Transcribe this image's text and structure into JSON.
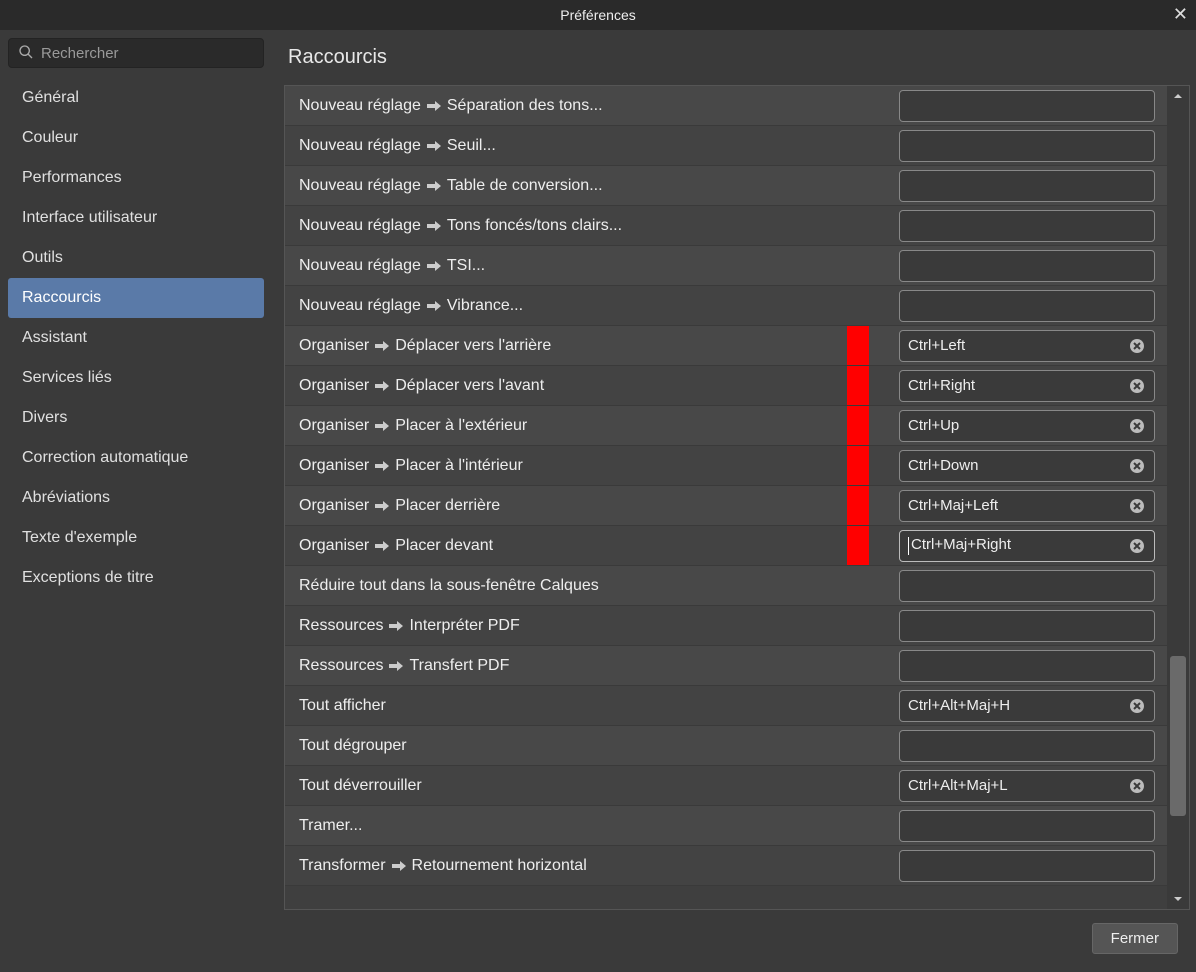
{
  "title": "Préférences",
  "search": {
    "placeholder": "Rechercher"
  },
  "sidebar": {
    "items": [
      {
        "label": "Général"
      },
      {
        "label": "Couleur"
      },
      {
        "label": "Performances"
      },
      {
        "label": "Interface utilisateur"
      },
      {
        "label": "Outils"
      },
      {
        "label": "Raccourcis",
        "selected": true
      },
      {
        "label": "Assistant"
      },
      {
        "label": "Services liés"
      },
      {
        "label": "Divers"
      },
      {
        "label": "Correction automatique"
      },
      {
        "label": "Abréviations"
      },
      {
        "label": "Texte d'exemple"
      },
      {
        "label": "Exceptions de titre"
      }
    ]
  },
  "main": {
    "title": "Raccourcis",
    "rows": [
      {
        "path": [
          "Nouveau réglage",
          "Séparation des tons..."
        ],
        "shortcut": ""
      },
      {
        "path": [
          "Nouveau réglage",
          "Seuil..."
        ],
        "shortcut": ""
      },
      {
        "path": [
          "Nouveau réglage",
          "Table de conversion..."
        ],
        "shortcut": ""
      },
      {
        "path": [
          "Nouveau réglage",
          "Tons foncés/tons clairs..."
        ],
        "shortcut": ""
      },
      {
        "path": [
          "Nouveau réglage",
          "TSI..."
        ],
        "shortcut": ""
      },
      {
        "path": [
          "Nouveau réglage",
          "Vibrance..."
        ],
        "shortcut": ""
      },
      {
        "path": [
          "Organiser",
          "Déplacer vers l'arrière"
        ],
        "shortcut": "Ctrl+Left",
        "hl": true
      },
      {
        "path": [
          "Organiser",
          "Déplacer vers l'avant"
        ],
        "shortcut": "Ctrl+Right",
        "hl": true
      },
      {
        "path": [
          "Organiser",
          "Placer à l'extérieur"
        ],
        "shortcut": "Ctrl+Up",
        "hl": true
      },
      {
        "path": [
          "Organiser",
          "Placer à l'intérieur"
        ],
        "shortcut": "Ctrl+Down",
        "hl": true
      },
      {
        "path": [
          "Organiser",
          "Placer derrière"
        ],
        "shortcut": "Ctrl+Maj+Left",
        "hl": true
      },
      {
        "path": [
          "Organiser",
          "Placer devant"
        ],
        "shortcut": "Ctrl+Maj+Right",
        "hl": true,
        "focused": true
      },
      {
        "path": [
          "Réduire tout dans la sous-fenêtre Calques"
        ],
        "shortcut": ""
      },
      {
        "path": [
          "Ressources",
          "Interpréter PDF"
        ],
        "shortcut": ""
      },
      {
        "path": [
          "Ressources",
          "Transfert PDF"
        ],
        "shortcut": ""
      },
      {
        "path": [
          "Tout afficher"
        ],
        "shortcut": "Ctrl+Alt+Maj+H"
      },
      {
        "path": [
          "Tout dégrouper"
        ],
        "shortcut": ""
      },
      {
        "path": [
          "Tout déverrouiller"
        ],
        "shortcut": "Ctrl+Alt+Maj+L"
      },
      {
        "path": [
          "Tramer..."
        ],
        "shortcut": ""
      },
      {
        "path": [
          "Transformer",
          "Retournement horizontal"
        ],
        "shortcut": ""
      }
    ]
  },
  "footer": {
    "close": "Fermer"
  }
}
